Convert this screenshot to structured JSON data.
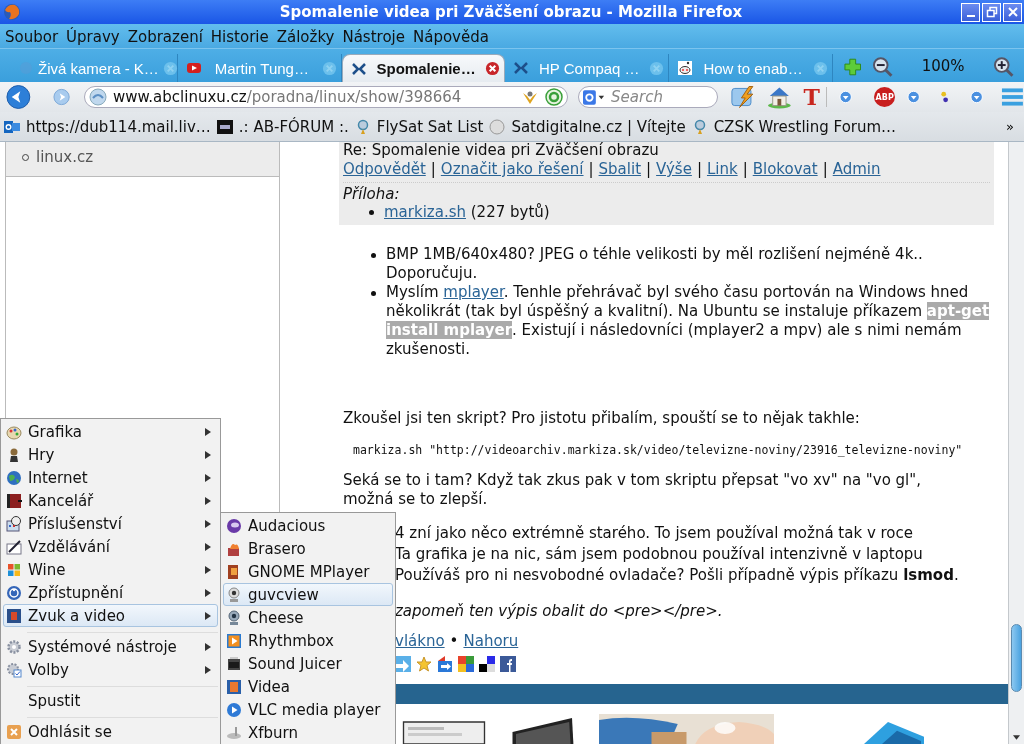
{
  "window": {
    "title": "Spomalenie videa pri Zväčšení obrazu - Mozilla Firefox"
  },
  "menu_bar": [
    "Soubor",
    "Úpravy",
    "Zobrazení",
    "Historie",
    "Záložky",
    "Nástroje",
    "Nápověda"
  ],
  "tabs": [
    {
      "label": "Živá kamera - K…",
      "selected": false
    },
    {
      "label": "Martin Tung…",
      "selected": false
    },
    {
      "label": "Spomalenie…",
      "selected": true
    },
    {
      "label": "HP Compaq …",
      "selected": false
    },
    {
      "label": "How to enab…",
      "selected": false
    }
  ],
  "zoom": {
    "reading": "100%"
  },
  "address_bar": {
    "domain": "www.abclinuxu.cz",
    "path": "/poradna/linux/show/398664"
  },
  "search": {
    "placeholder": "Search"
  },
  "toolbar": {
    "text_icon": "T",
    "adblock_label": "ABP"
  },
  "bookmarks": {
    "items": [
      "https://dub114.mail.liv…",
      ".: AB-FÓRUM :.",
      "FlySat Sat List",
      "Satdigitalne.cz | Vítejte",
      "CZSK Wrestling Forum…"
    ],
    "overflow": "»"
  },
  "sidebar": {
    "links": [
      "linux.cz"
    ]
  },
  "post": {
    "heading": "Re: Spomalenie videa pri Zväčšení obrazu",
    "separator": "|",
    "actions": [
      "Odpovědět",
      "Označit jako řešení",
      "Sbalit",
      "Výše",
      "Link",
      "Blokovat",
      "Admin"
    ],
    "attachment_label": "Příloha:",
    "attachment": {
      "name": "markiza.sh",
      "size": "(227 bytů)"
    }
  },
  "answer": {
    "items": [
      [
        {
          "kind": "text",
          "text": "BMP 1MB/640x480? JPEG o téhle velikosti by měl rozlišení nejméně 4k.. Doporučuju."
        }
      ],
      [
        {
          "kind": "text",
          "text": "Myslím "
        },
        {
          "kind": "link",
          "text": "mplayer"
        },
        {
          "kind": "text",
          "text": ". Tenhle přehrávač byl svého času portován na Windows hned několikrát (tak byl úspěšný a kvalitní). Na Ubuntu se instaluje příkazem "
        },
        {
          "kind": "code",
          "text": "apt-get install mplayer"
        },
        {
          "kind": "text",
          "text": ". Existují i následovníci (mplayer2 a mpv) ale s nimi nemám zkušenosti."
        }
      ]
    ]
  },
  "reply": {
    "question": "Zkoušel jsi ten skript? Pro jistotu přibalím, spouští se to nějak takhle:",
    "code": "markiza.sh \"http://videoarchiv.markiza.sk/video/televizne-noviny/23916_televizne-noviny\"",
    "paragraph": "Seká se to i tam? Když tak zkus pak v tom skriptu přepsat \"vo xv\" na \"vo gl\", možná se to zlepší.",
    "lines": [
      "4 zní jako něco extrémně starého. To jsem používal možná tak v roce",
      "Ta grafika je na nic, sám jsem podobnou používal intenzivně v laptopu",
      "Používáš pro ni nesvobodné ovladače? Pošli případně výpis příkazu **lsmod**."
    ],
    "note": "zapomeň ten výpis obalit do <pre></pre>.",
    "links": [
      "vlákno",
      "Nahoru"
    ],
    "link_separator": "•"
  },
  "app_menu": {
    "items": [
      {
        "kind": "category",
        "label": "Grafika",
        "selected": false
      },
      {
        "kind": "category",
        "label": "Hry",
        "selected": false
      },
      {
        "kind": "category",
        "label": "Internet",
        "selected": false
      },
      {
        "kind": "category",
        "label": "Kancelář",
        "selected": false
      },
      {
        "kind": "category",
        "label": "Příslušenství",
        "selected": false
      },
      {
        "kind": "category",
        "label": "Vzdělávání",
        "selected": false
      },
      {
        "kind": "category",
        "label": "Wine",
        "selected": false
      },
      {
        "kind": "category",
        "label": "Zpřístupnění",
        "selected": false
      },
      {
        "kind": "category",
        "label": "Zvuk a video",
        "selected": true
      },
      {
        "kind": "separator"
      },
      {
        "kind": "category",
        "label": "Systémové nástroje",
        "selected": false
      },
      {
        "kind": "category",
        "label": "Volby",
        "selected": false
      },
      {
        "kind": "separator"
      },
      {
        "kind": "action",
        "label": "Spustit",
        "selected": false
      },
      {
        "kind": "separator"
      },
      {
        "kind": "action",
        "label": "Odhlásit se",
        "selected": false
      }
    ]
  },
  "submenu": {
    "items": [
      {
        "label": "Audacious",
        "selected": false
      },
      {
        "label": "Brasero",
        "selected": false
      },
      {
        "label": "GNOME MPlayer",
        "selected": false
      },
      {
        "label": "guvcview",
        "selected": true
      },
      {
        "label": "Cheese",
        "selected": false
      },
      {
        "label": "Rhythmbox",
        "selected": false
      },
      {
        "label": "Sound Juicer",
        "selected": false
      },
      {
        "label": "Videa",
        "selected": false
      },
      {
        "label": "VLC media player",
        "selected": false
      },
      {
        "label": "Xfburn",
        "selected": false
      }
    ]
  }
}
